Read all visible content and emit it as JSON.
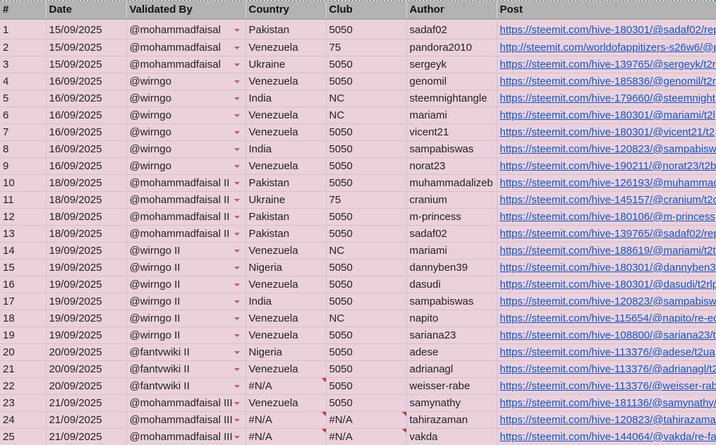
{
  "colors": {
    "row_bg": "#ead1dc",
    "header_bg": "#b3b3b3",
    "link": "#1155cc",
    "dropdown_arrow": "#c0576f",
    "error_marker": "#d9271f"
  },
  "headers": [
    "#",
    "Date",
    "Validated By",
    "Country",
    "Club",
    "Author",
    "Post"
  ],
  "rows": [
    {
      "n": "1",
      "date": "15/09/2025",
      "validator": "@mohammadfaisal",
      "country": "Pakistan",
      "club": "5050",
      "author": "sadaf02",
      "post": "https://steemit.com/hive-180301/@sadaf02/rep"
    },
    {
      "n": "2",
      "date": "15/09/2025",
      "validator": "@mohammadfaisal",
      "country": "Venezuela",
      "club": "75",
      "author": "pandora2010",
      "post": "http://steemit.com/worldofappitizers-s26w6/@p"
    },
    {
      "n": "3",
      "date": "15/09/2025",
      "validator": "@mohammadfaisal",
      "country": "Ukraine",
      "club": "5050",
      "author": "sergeyk",
      "post": "https://steemit.com/hive-139765/@sergeyk/t2r"
    },
    {
      "n": "4",
      "date": "16/09/2025",
      "validator": "@wirngo",
      "country": "Venezuela",
      "club": "5050",
      "author": "genomil",
      "post": "https://steemit.com/hive-185836/@genomil/t2r"
    },
    {
      "n": "5",
      "date": "16/09/2025",
      "validator": "@wirngo",
      "country": "India",
      "club": "NC",
      "author": "steemnightangle",
      "post": "https://steemit.com/hive-179660/@steemnight"
    },
    {
      "n": "6",
      "date": "16/09/2025",
      "validator": "@wirngo",
      "country": "Venezuela",
      "club": "NC",
      "author": "mariami",
      "post": "https://steemit.com/hive-180301/@mariami/t2l"
    },
    {
      "n": "7",
      "date": "16/09/2025",
      "validator": "@wirngo",
      "country": "Venezuela",
      "club": "5050",
      "author": "vicent21",
      "post": "https://steemit.com/hive-180301/@vicent21/t2"
    },
    {
      "n": "8",
      "date": "16/09/2025",
      "validator": "@wirngo",
      "country": "India",
      "club": "5050",
      "author": "sampabiswas",
      "post": "https://steemit.com/hive-120823/@sampabisw"
    },
    {
      "n": "9",
      "date": "16/09/2025",
      "validator": "@wirngo",
      "country": "Venezuela",
      "club": "5050",
      "author": "norat23",
      "post": "https://steemit.com/hive-190211/@norat23/t2b"
    },
    {
      "n": "10",
      "date": "18/09/2025",
      "validator": "@mohammadfaisal II",
      "country": "Pakistan",
      "club": "5050",
      "author": "muhammadalizeb",
      "post": "https://steemit.com/hive-126193/@muhammad"
    },
    {
      "n": "11",
      "date": "18/09/2025",
      "validator": "@mohammadfaisal II",
      "country": "Ukraine",
      "club": "75",
      "author": "cranium",
      "post": "https://steemit.com/hive-145157/@cranium/t2c"
    },
    {
      "n": "12",
      "date": "18/09/2025",
      "validator": "@mohammadfaisal II",
      "country": "Pakistan",
      "club": "5050",
      "author": "m-princess",
      "post": "https://steemit.com/hive-180106/@m-princess"
    },
    {
      "n": "13",
      "date": "18/09/2025",
      "validator": "@mohammadfaisal II",
      "country": "Pakistan",
      "club": "5050",
      "author": "sadaf02",
      "post": "https://steemit.com/hive-139765/@sadaf02/rep"
    },
    {
      "n": "14",
      "date": "19/09/2025",
      "validator": "@wirngo II",
      "country": "Venezuela",
      "club": "NC",
      "author": "mariami",
      "post": "https://steemit.com/hive-188619/@mariami/t2t"
    },
    {
      "n": "15",
      "date": "19/09/2025",
      "validator": "@wirngo II",
      "country": "Nigeria",
      "club": "5050",
      "author": "dannyben39",
      "post": "https://steemit.com/hive-180301/@dannyben3"
    },
    {
      "n": "16",
      "date": "19/09/2025",
      "validator": "@wirngo II",
      "country": "Venezuela",
      "club": "5050",
      "author": "dasudi",
      "post": "https://steemit.com/hive-180301/@dasudi/t2rlp"
    },
    {
      "n": "17",
      "date": "19/09/2025",
      "validator": "@wirngo II",
      "country": "India",
      "club": "5050",
      "author": "sampabiswas",
      "post": "https://steemit.com/hive-120823/@sampabisw"
    },
    {
      "n": "18",
      "date": "19/09/2025",
      "validator": "@wirngo II",
      "country": "Venezuela",
      "club": "NC",
      "author": "napito",
      "post": "https://steemit.com/hive-115654/@napito/re-ec"
    },
    {
      "n": "19",
      "date": "19/09/2025",
      "validator": "@wirngo II",
      "country": "Venezuela",
      "club": "5050",
      "author": "sariana23",
      "post": "https://steemit.com/hive-108800/@sariana23/t"
    },
    {
      "n": "20",
      "date": "20/09/2025",
      "validator": "@fantvwiki II",
      "country": "Nigeria",
      "club": "5050",
      "author": "adese",
      "post": "https://steemit.com/hive-113376/@adese/t2ua"
    },
    {
      "n": "21",
      "date": "20/09/2025",
      "validator": "@fantvwiki II",
      "country": "Venezuela",
      "club": "5050",
      "author": "adrianagl",
      "post": "https://steemit.com/hive-113376/@adrianagl/t2"
    },
    {
      "n": "22",
      "date": "20/09/2025",
      "validator": "@fantvwiki II",
      "country": "#N/A",
      "club": "5050",
      "author": "weisser-rabe",
      "post": "https://steemit.com/hive-113376/@weisser-rab"
    },
    {
      "n": "23",
      "date": "21/09/2025",
      "validator": "@mohammadfaisal III",
      "country": "Venezuela",
      "club": "5050",
      "author": "samynathy",
      "post": "https://steemit.com/hive-181136/@samynathy/"
    },
    {
      "n": "24",
      "date": "21/09/2025",
      "validator": "@mohammadfaisal III",
      "country": "#N/A",
      "club": "#N/A",
      "author": "tahirazaman",
      "post": "https://steemit.com/hive-120823/@tahirazama"
    },
    {
      "n": "25",
      "date": "21/09/2025",
      "validator": "@mohammadfaisal III",
      "country": "#N/A",
      "club": "#N/A",
      "author": "vakda",
      "post": "https://steemit.com/hive-144064/@vakda/re-fa"
    }
  ]
}
